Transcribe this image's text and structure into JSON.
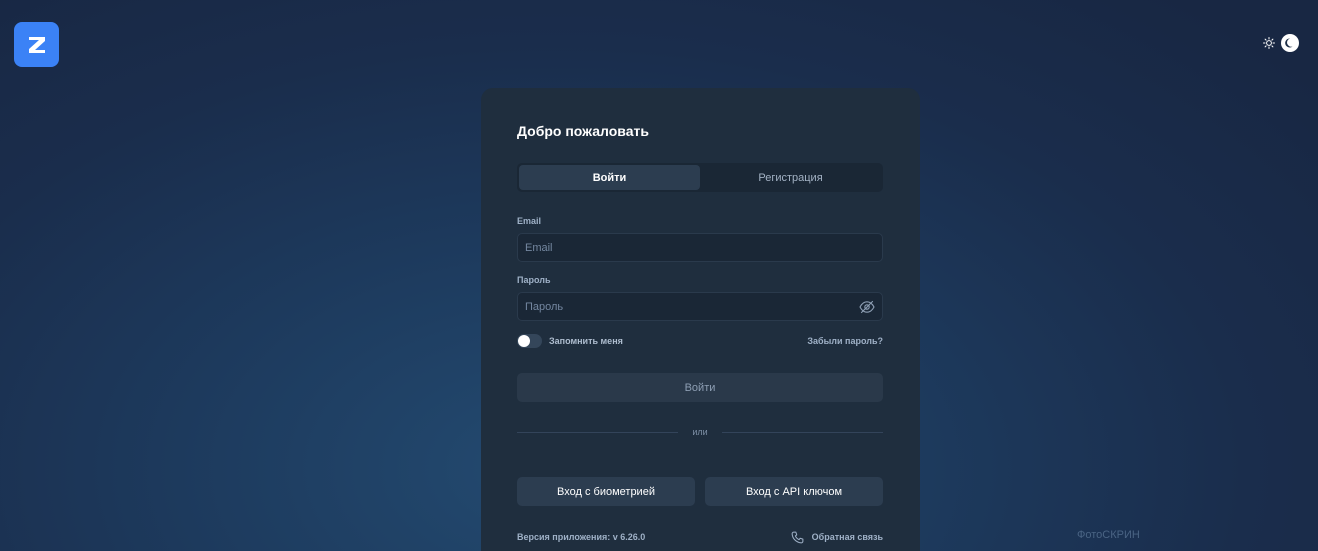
{
  "app": {
    "logo_icon": "z-logo-icon",
    "brand_color": "#3b82f6"
  },
  "theme": {
    "light_icon": "sun-icon",
    "dark_icon": "moon-icon",
    "selected": "dark"
  },
  "card": {
    "title": "Добро пожаловать"
  },
  "tabs": [
    {
      "label": "Войти",
      "active": true
    },
    {
      "label": "Регистрация",
      "active": false
    }
  ],
  "form": {
    "email": {
      "label": "Email",
      "placeholder": "Email",
      "value": ""
    },
    "password": {
      "label": "Пароль",
      "placeholder": "Пароль",
      "value": "",
      "toggle_icon": "eye-off-icon"
    },
    "remember_label": "Запомнить меня",
    "remember_checked": false,
    "forgot_label": "Забыли пароль?",
    "submit_label": "Войти"
  },
  "divider_label": "или",
  "alt_logins": {
    "biometric_label": "Вход с биометрией",
    "api_key_label": "Вход с API ключом"
  },
  "footer": {
    "version": "Версия приложения: v 6.26.0",
    "feedback_label": "Обратная связь",
    "feedback_icon": "phone-icon"
  },
  "watermark": "ФотоСКРИН"
}
